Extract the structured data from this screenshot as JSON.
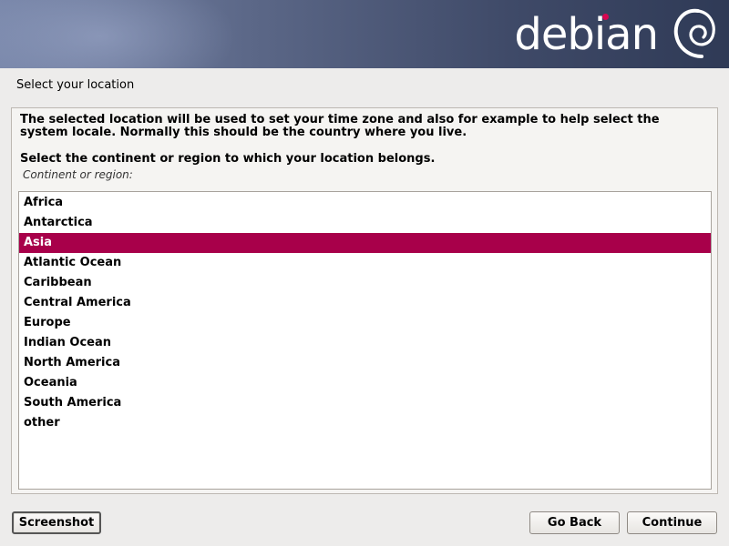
{
  "banner": {
    "logo_text": "debian",
    "logo_icon": "debian-swirl-icon",
    "dot_color": "#d70751"
  },
  "page": {
    "title": "Select your location"
  },
  "content": {
    "description": "The selected location will be used to set your time zone and also for example to help select the system locale. Normally this should be the country where you live.",
    "prompt": "Select the continent or region to which your location belongs.",
    "field_label": "Continent or region:",
    "selected_value": "Asia",
    "selection_color": "#a8004a",
    "regions": [
      "Africa",
      "Antarctica",
      "Asia",
      "Atlantic Ocean",
      "Caribbean",
      "Central America",
      "Europe",
      "Indian Ocean",
      "North America",
      "Oceania",
      "South America",
      "other"
    ]
  },
  "buttons": {
    "screenshot": "Screenshot",
    "go_back": "Go Back",
    "continue": "Continue"
  }
}
